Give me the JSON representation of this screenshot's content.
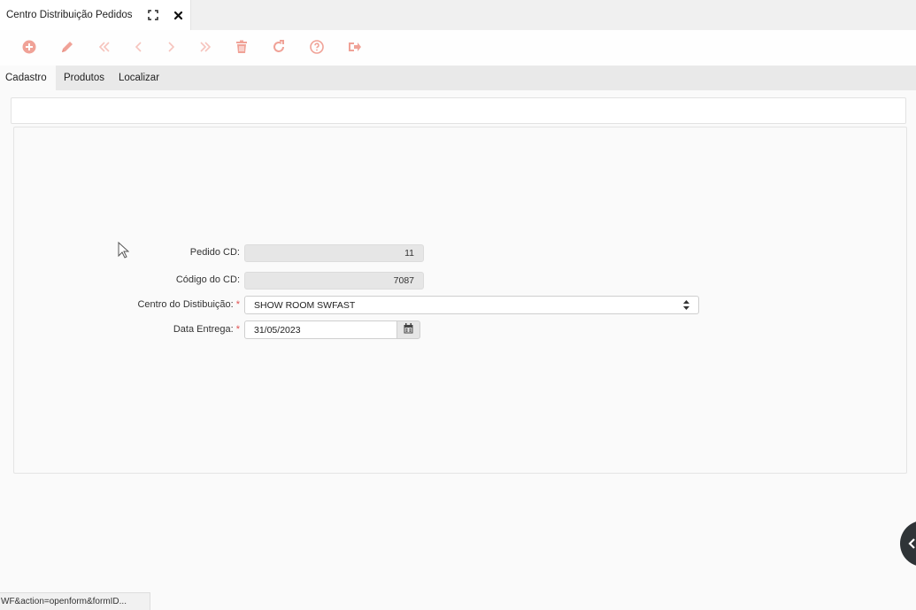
{
  "window": {
    "title": "Centro Distribuição Pedidos",
    "maximize_icon": "expand-icon",
    "close_icon": "close-icon"
  },
  "toolbar": {
    "color": "#f0a297",
    "buttons": [
      "add-icon",
      "edit-icon",
      "first-record-icon",
      "previous-record-icon",
      "next-record-icon",
      "last-record-icon",
      "delete-icon",
      "refresh-icon",
      "help-icon",
      "exit-icon"
    ]
  },
  "tabs": [
    {
      "label": "Cadastro",
      "active": true
    },
    {
      "label": "Produtos",
      "active": false
    },
    {
      "label": "Localizar",
      "active": false
    }
  ],
  "form": {
    "pedido_cd": {
      "label": "Pedido CD:",
      "value": "11"
    },
    "codigo_cd": {
      "label": "Código do CD:",
      "value": "7087"
    },
    "centro": {
      "label": "Centro do Distibuição:",
      "required_mark": "*",
      "value": "SHOW ROOM SWFAST"
    },
    "data_entrega": {
      "label": "Data Entrega:",
      "required_mark": "*",
      "value": "31/05/2023"
    }
  },
  "status": {
    "url": "WF&action=openform&formID..."
  }
}
